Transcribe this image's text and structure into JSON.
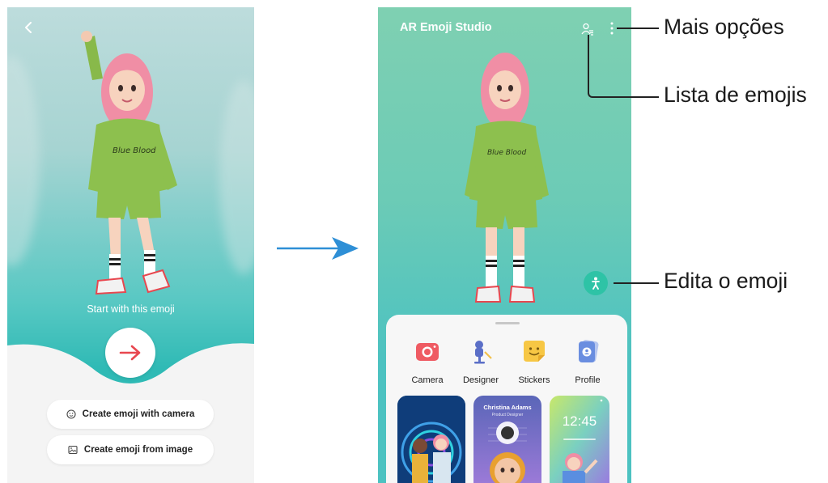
{
  "left_screen": {
    "start_text": "Start with this emoji",
    "create_camera_label": "Create emoji with camera",
    "create_image_label": "Create emoji from image",
    "icons": {
      "back": "back-chevron-icon",
      "next": "arrow-right-icon",
      "camera_option": "face-icon",
      "image_option": "image-icon"
    }
  },
  "right_screen": {
    "app_title": "AR Emoji Studio",
    "features": [
      {
        "label": "Camera",
        "icon": "camera-icon",
        "color": "#ef5b63"
      },
      {
        "label": "Designer",
        "icon": "designer-icon",
        "color": "#5b6fc7"
      },
      {
        "label": "Stickers",
        "icon": "sticker-icon",
        "color": "#f7c744"
      },
      {
        "label": "Profile",
        "icon": "profile-icon",
        "color": "#6a8ee0"
      }
    ],
    "thumbnail_2": {
      "name": "Christina Adams",
      "subtitle": "Product Designer"
    },
    "thumbnail_3": {
      "time": "12:45"
    }
  },
  "callouts": {
    "more_options": "Mais opções",
    "emoji_list": "Lista de emojis",
    "edit_emoji": "Edita o emoji"
  },
  "colors": {
    "arrow": "#2e8fd6",
    "accent_red": "#e8474f",
    "teal": "#2ec3a6"
  }
}
